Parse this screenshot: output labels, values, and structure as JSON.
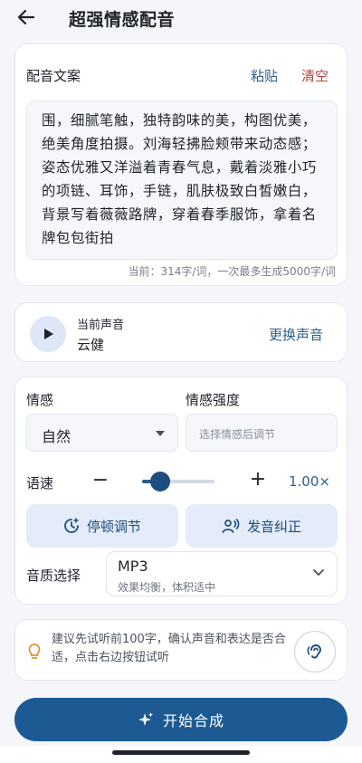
{
  "header": {
    "title": "超强情感配音"
  },
  "script": {
    "heading": "配音文案",
    "paste_label": "粘贴",
    "clear_label": "清空",
    "text": "围，细腻笔触，独特韵味的美，构图优美，绝美角度拍摄。刘海轻拂脸颊带来动态感；姿态优雅又洋溢着青春气息，戴着淡雅小巧的项链、耳饰，手链，肌肤极致白皙嫩白，背景写着薇薇路牌，穿着春季服饰，拿着名牌包包街拍",
    "count_text": "当前：314字/词，一次最多生成5000字/词"
  },
  "voice": {
    "label": "当前声音",
    "name": "云健",
    "change_label": "更换声音"
  },
  "settings": {
    "emotion_label": "情感",
    "emotion_value": "自然",
    "intensity_label": "情感强度",
    "intensity_placeholder": "选择情感后调节",
    "speed_label": "语速",
    "speed_minus": "−",
    "speed_plus": "+",
    "speed_value": "1.00×",
    "speed_fraction": 0.25,
    "pause_label": "停顿调节",
    "pronunciation_label": "发音纠正",
    "quality_label": "音质选择",
    "quality_value": "MP3",
    "quality_desc": "效果均衡，体积适中"
  },
  "tip": {
    "text": "建议先试听前100字，确认声音和表达是否合适，点击右边按钮试听"
  },
  "action": {
    "start_label": "开始合成"
  },
  "colors": {
    "accent": "#1d5a94",
    "link": "#2f5d8a",
    "danger": "#b5453d",
    "tip_icon": "#e0902a"
  }
}
